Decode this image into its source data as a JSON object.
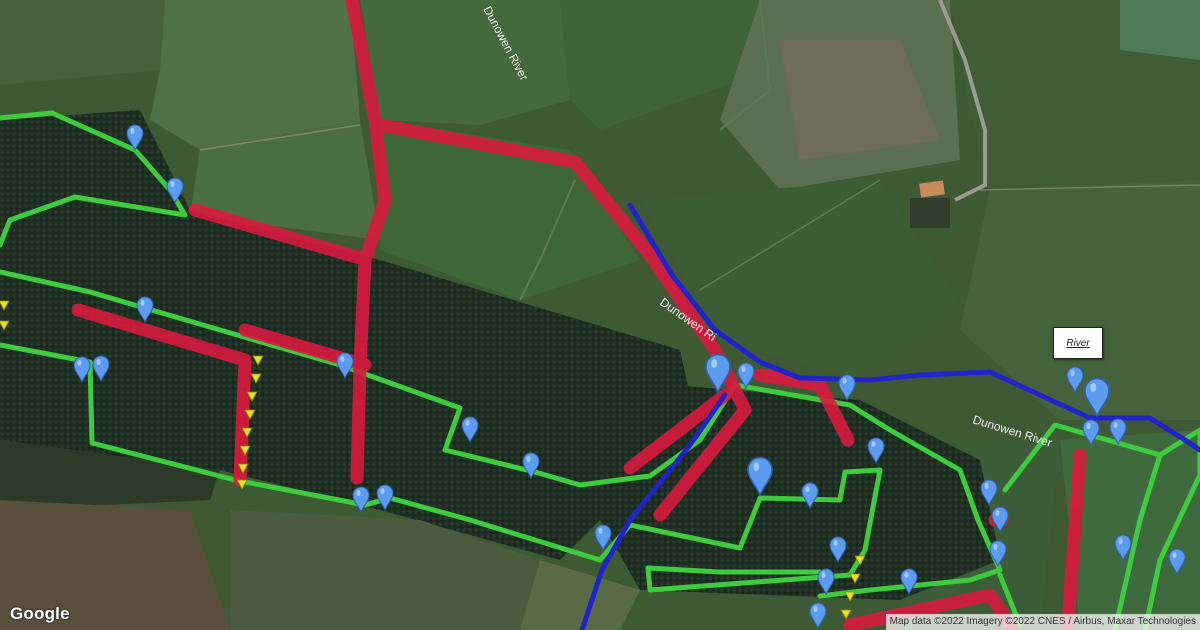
{
  "map": {
    "river_labels": [
      "Dunowen River",
      "Dunowen Ri",
      "Dunowen River"
    ],
    "info_box_label": "River",
    "logo": "Google",
    "attribution": "Map data ©2022 Imagery ©2022 CNES / Airbus, Maxar Technologies",
    "colors": {
      "green_route": "#3dcc3d",
      "red_route": "#d9193f",
      "river_line": "#2222cc",
      "marker": "#5b9cf0",
      "marker_outline": "#2f5fb0",
      "arrow_marker": "#e8e020"
    },
    "icons": [
      "location-pin-icon",
      "direction-arrow-icon"
    ]
  }
}
